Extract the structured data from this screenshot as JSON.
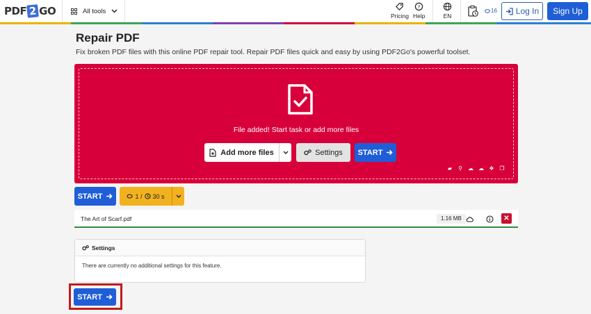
{
  "header": {
    "logo": {
      "left": "PDF",
      "mid": "2",
      "right": "GO"
    },
    "all_tools": "All tools",
    "pricing": "Pricing",
    "help": "Help",
    "language": "EN",
    "counter": "16",
    "login": "Log In",
    "signup": "Sign Up"
  },
  "page": {
    "title": "Repair PDF",
    "subtitle": "Fix broken PDF files with this online PDF repair tool. Repair PDF files quick and easy by using PDF2Go's powerful toolset."
  },
  "dropzone": {
    "status": "File added! Start task or add more files",
    "add_more": "Add more files",
    "settings": "Settings",
    "start": "START"
  },
  "actions": {
    "start": "START",
    "limits": {
      "count": "1 /",
      "time": "30 s"
    }
  },
  "file": {
    "name": "The Art of Scarf.pdf",
    "size": "1.16 MB"
  },
  "settings_panel": {
    "title": "Settings",
    "message": "There are currently no additional settings for this feature."
  },
  "bottom": {
    "start": "START"
  },
  "colors": {
    "brand_red": "#d8003a",
    "primary_blue": "#1f5ed6",
    "warning_yellow": "#f2b21f",
    "success_green": "#2e8b3d",
    "highlight_red": "#c21a1a"
  }
}
